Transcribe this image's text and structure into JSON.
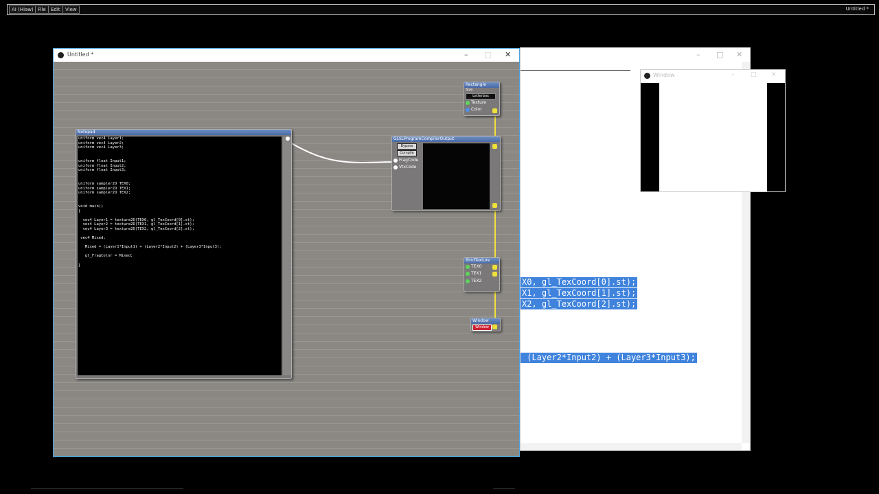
{
  "topbar": {
    "menu": [
      "AI (Hiaw)",
      "File",
      "Edit",
      "View"
    ],
    "document_title": "Untitled *"
  },
  "main_window": {
    "title": "Untitled *",
    "controls": [
      "–",
      "□",
      "✕"
    ]
  },
  "back_window": {
    "controls": [
      "–",
      "□",
      "✕"
    ],
    "code_lines": [
      "X0, gl_TexCoord[0].st);",
      "X1, gl_TexCoord[1].st);",
      "X2, gl_TexCoord[2].st);",
      " (Layer2*Input2) + (Layer3*Input3);"
    ]
  },
  "output_window": {
    "title": "Window",
    "controls": [
      "–",
      "□",
      "✕"
    ]
  },
  "nodes": {
    "notepad": {
      "title": "Notepad",
      "code": "uniform vec4 Layer1;\nuniform vec4 Layer2;\nuniform vec4 Layer3;\n\n\nuniform float Input1;\nuniform float Input2;\nuniform float Input3;\n\n\nuniform sampler2D TEX0;\nuniform sampler2D TEX1;\nuniform sampler2D TEX2;\n\n\nvoid main()\n{\n\n  vec4 Layer1 = texture2D(TEX0, gl_TexCoord[0].st);\n  vec4 Layer2 = texture2D(TEX1, gl_TexCoord[1].st);\n  vec4 Layer3 = texture2D(TEX2, gl_TexCoord[2].st);\n\n vec4 Mixed;\n\n   Mixed = (Layer1*Input1) + (Layer2*Input2) + (Layer3*Input3);\n\n   gl_FragColor = Mixed;\n\n}"
    },
    "glsl": {
      "title": "GLSLProgramCompilerOutput",
      "bypass": "Bypass",
      "compile": "Compile",
      "port_frag": "FragCode",
      "port_vtx": "VtxCode"
    },
    "rectangle": {
      "title": "Rectangle",
      "size_label": "Size",
      "size_value": "Letterbox",
      "port_texture": "Texture",
      "port_color": "Color"
    },
    "bindtexture": {
      "title": "BindTexture",
      "ports": [
        "TEX0",
        "TEX1",
        "TEX2"
      ]
    },
    "window": {
      "title": "Window",
      "button": "Window"
    }
  }
}
